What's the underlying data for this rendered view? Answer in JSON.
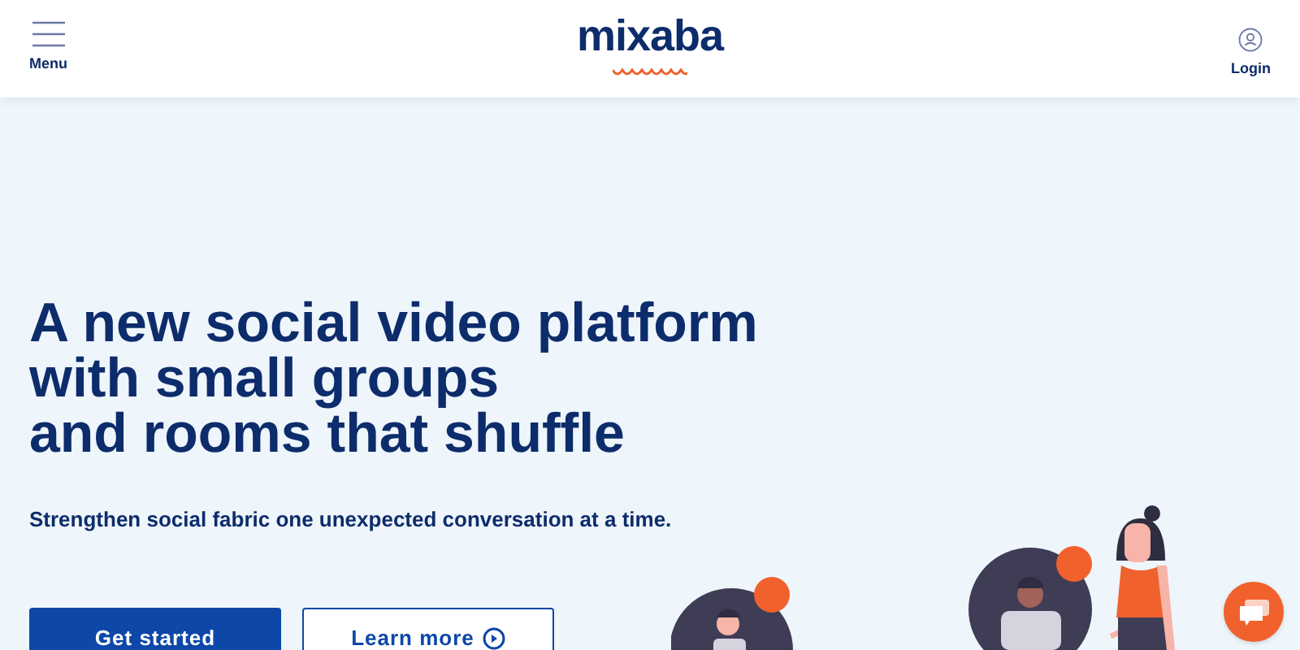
{
  "header": {
    "menu_label": "Menu",
    "logo": "mixaba",
    "login_label": "Login"
  },
  "hero": {
    "headline_lines": [
      "A new social video platform",
      "with small groups",
      "and rooms that shuffle"
    ],
    "subtitle": "Strengthen social fabric one unexpected conversation at a time.",
    "buttons": [
      {
        "label": "Get started",
        "kind": "primary"
      },
      {
        "label": "Learn more",
        "kind": "secondary"
      }
    ]
  }
}
